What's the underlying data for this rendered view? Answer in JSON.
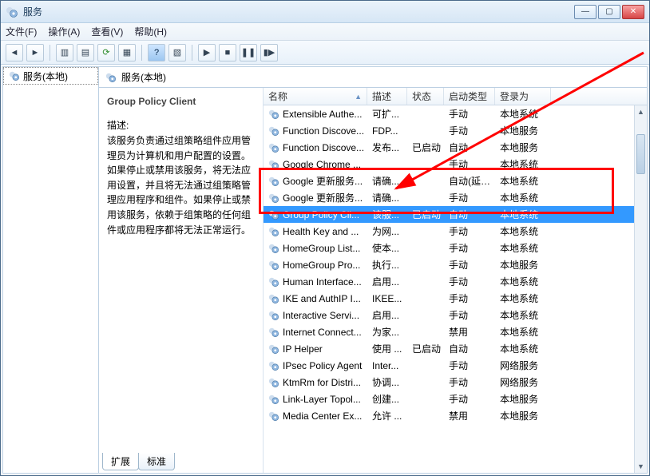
{
  "window": {
    "title": "服务"
  },
  "menu": {
    "file": "文件(F)",
    "action": "操作(A)",
    "view": "查看(V)",
    "help": "帮助(H)"
  },
  "nav": {
    "root": "服务(本地)"
  },
  "detail": {
    "heading": "服务(本地)",
    "selected_name": "Group Policy Client",
    "desc_label": "描述:",
    "desc": "该服务负责通过组策略组件应用管理员为计算机和用户配置的设置。如果停止或禁用该服务，将无法应用设置，并且将无法通过组策略管理应用程序和组件。如果停止或禁用该服务，依赖于组策略的任何组件或应用程序都将无法正常运行。"
  },
  "columns": {
    "name": "名称",
    "desc": "描述",
    "status": "状态",
    "startup": "启动类型",
    "logon": "登录为"
  },
  "tabs": {
    "extended": "扩展",
    "standard": "标准"
  },
  "services": [
    {
      "name": "Extensible Authe...",
      "desc": "可扩...",
      "status": "",
      "start": "手动",
      "logon": "本地系统"
    },
    {
      "name": "Function Discove...",
      "desc": "FDP...",
      "status": "",
      "start": "手动",
      "logon": "本地服务"
    },
    {
      "name": "Function Discove...",
      "desc": "发布...",
      "status": "已启动",
      "start": "自动",
      "logon": "本地服务"
    },
    {
      "name": "Google Chrome ...",
      "desc": "",
      "status": "",
      "start": "手动",
      "logon": "本地系统"
    },
    {
      "name": "Google 更新服务...",
      "desc": "请确...",
      "status": "",
      "start": "自动(延迟...",
      "logon": "本地系统"
    },
    {
      "name": "Google 更新服务...",
      "desc": "请确...",
      "status": "",
      "start": "手动",
      "logon": "本地系统"
    },
    {
      "name": "Group Policy Cli...",
      "desc": "该服...",
      "status": "已启动",
      "start": "自动",
      "logon": "本地系统",
      "selected": true
    },
    {
      "name": "Health Key and ...",
      "desc": "为网...",
      "status": "",
      "start": "手动",
      "logon": "本地系统"
    },
    {
      "name": "HomeGroup List...",
      "desc": "使本...",
      "status": "",
      "start": "手动",
      "logon": "本地系统"
    },
    {
      "name": "HomeGroup Pro...",
      "desc": "执行...",
      "status": "",
      "start": "手动",
      "logon": "本地服务"
    },
    {
      "name": "Human Interface...",
      "desc": "启用...",
      "status": "",
      "start": "手动",
      "logon": "本地系统"
    },
    {
      "name": "IKE and AuthIP I...",
      "desc": "IKEE...",
      "status": "",
      "start": "手动",
      "logon": "本地系统"
    },
    {
      "name": "Interactive Servi...",
      "desc": "启用...",
      "status": "",
      "start": "手动",
      "logon": "本地系统"
    },
    {
      "name": "Internet Connect...",
      "desc": "为家...",
      "status": "",
      "start": "禁用",
      "logon": "本地系统"
    },
    {
      "name": "IP Helper",
      "desc": "使用 ...",
      "status": "已启动",
      "start": "自动",
      "logon": "本地系统"
    },
    {
      "name": "IPsec Policy Agent",
      "desc": "Inter...",
      "status": "",
      "start": "手动",
      "logon": "网络服务"
    },
    {
      "name": "KtmRm for Distri...",
      "desc": "协调...",
      "status": "",
      "start": "手动",
      "logon": "网络服务"
    },
    {
      "name": "Link-Layer Topol...",
      "desc": "创建...",
      "status": "",
      "start": "手动",
      "logon": "本地服务"
    },
    {
      "name": "Media Center Ex...",
      "desc": "允许 ...",
      "status": "",
      "start": "禁用",
      "logon": "本地服务"
    }
  ]
}
